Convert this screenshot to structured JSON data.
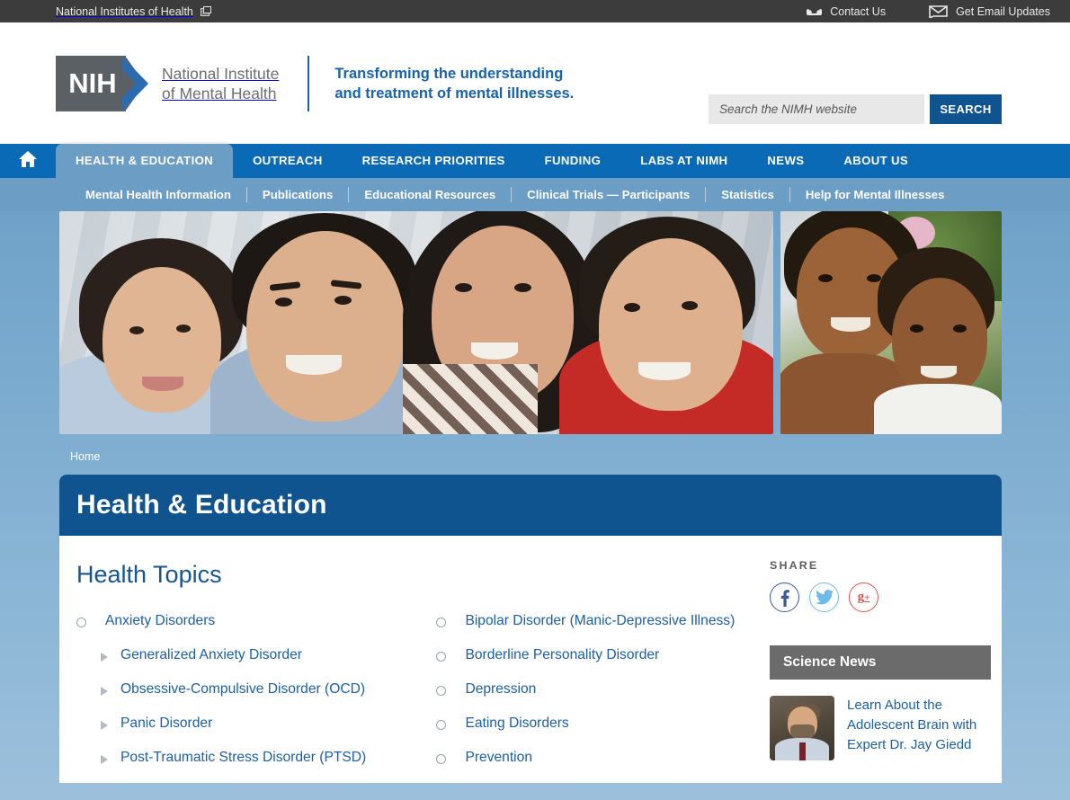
{
  "topbar": {
    "agency": "National Institutes of Health",
    "agency_icon": "external-link-icon",
    "contact": "Contact Us",
    "contact_icon": "phone-icon",
    "email_updates": "Get Email Updates",
    "email_icon": "envelope-icon"
  },
  "masthead": {
    "logo_text": "NIH",
    "institute_name": "National Institute\nof Mental Health",
    "tagline": "Transforming the understanding\nand treatment of mental illnesses.",
    "search_placeholder": "Search the NIMH website",
    "search_value": "",
    "search_button": "SEARCH"
  },
  "mainnav": {
    "home_icon": "home-icon",
    "items": [
      {
        "label": "HEALTH & EDUCATION",
        "active": true
      },
      {
        "label": "OUTREACH",
        "active": false
      },
      {
        "label": "RESEARCH PRIORITIES",
        "active": false
      },
      {
        "label": "FUNDING",
        "active": false
      },
      {
        "label": "LABS AT NIMH",
        "active": false
      },
      {
        "label": "NEWS",
        "active": false
      },
      {
        "label": "ABOUT US",
        "active": false
      }
    ]
  },
  "subnav": {
    "items": [
      {
        "label": "Mental Health Information"
      },
      {
        "label": "Publications"
      },
      {
        "label": "Educational Resources"
      },
      {
        "label": "Clinical Trials — Participants"
      },
      {
        "label": "Statistics"
      },
      {
        "label": "Help for Mental Illnesses"
      }
    ]
  },
  "hero": {
    "main_alt": "Family of four smiling together outdoors",
    "side_alt": "Mother and daughter smiling together"
  },
  "breadcrumb": {
    "items": [
      {
        "label": "Home"
      }
    ]
  },
  "page": {
    "title": "Health & Education",
    "section_title": "Health Topics"
  },
  "topics": {
    "left": [
      {
        "label": "Anxiety Disorders",
        "level": 1
      },
      {
        "label": "Generalized Anxiety Disorder",
        "level": 2
      },
      {
        "label": "Obsessive-Compulsive Disorder (OCD)",
        "level": 2
      },
      {
        "label": "Panic Disorder",
        "level": 2
      },
      {
        "label": "Post-Traumatic Stress Disorder (PTSD)",
        "level": 2
      }
    ],
    "right": [
      {
        "label": "Bipolar Disorder (Manic-Depressive Illness)",
        "level": 1
      },
      {
        "label": "Borderline Personality Disorder",
        "level": 1
      },
      {
        "label": "Depression",
        "level": 1
      },
      {
        "label": "Eating Disorders",
        "level": 1
      },
      {
        "label": "Prevention",
        "level": 1
      }
    ]
  },
  "share": {
    "label": "SHARE",
    "buttons": [
      {
        "name": "facebook",
        "glyph": "f",
        "color": "#3a5a98"
      },
      {
        "name": "twitter",
        "glyph": "ᵗ",
        "color": "#6fbbe8"
      },
      {
        "name": "googleplus",
        "glyph": "g+",
        "color": "#d9534f"
      }
    ]
  },
  "science_news": {
    "heading": "Science News",
    "item_title": "Learn About the Adolescent Brain with Expert Dr. Jay Giedd",
    "item_thumb_alt": "Portrait of Dr. Jay Giedd"
  },
  "colors": {
    "brand_blue": "#10548f",
    "nav_blue": "#0a6ab5",
    "subnav_blue": "#6c9dc4",
    "link_blue": "#1b5fa6",
    "topbar_gray": "#3c3c3c",
    "news_header_gray": "#6b6b6b"
  }
}
